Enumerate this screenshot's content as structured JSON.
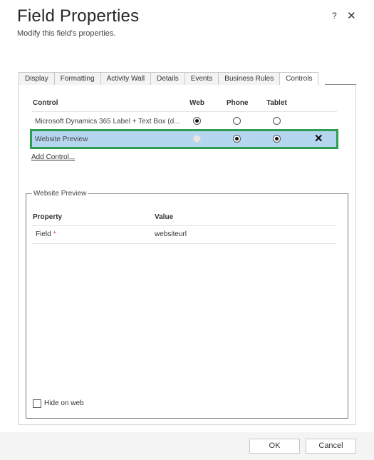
{
  "dialog": {
    "title": "Field Properties",
    "subtitle": "Modify this field's properties.",
    "help_label": "?",
    "close_label": "✕"
  },
  "tabs": [
    {
      "label": "Display",
      "active": false
    },
    {
      "label": "Formatting",
      "active": false
    },
    {
      "label": "Activity Wall",
      "active": false
    },
    {
      "label": "Details",
      "active": false
    },
    {
      "label": "Events",
      "active": false
    },
    {
      "label": "Business Rules",
      "active": false
    },
    {
      "label": "Controls",
      "active": true
    }
  ],
  "controls_table": {
    "columns": [
      "Control",
      "Web",
      "Phone",
      "Tablet"
    ],
    "rows": [
      {
        "name": "Microsoft Dynamics 365 Label + Text Box (d...",
        "web": "checked",
        "phone": "unchecked",
        "tablet": "unchecked",
        "selected": false
      },
      {
        "name": "Website Preview",
        "web": "disabled",
        "phone": "checked",
        "tablet": "checked",
        "selected": true,
        "remove_label": "✕"
      }
    ],
    "add_control_label": "Add Control..."
  },
  "properties": {
    "legend": "Website Preview",
    "columns": [
      "Property",
      "Value"
    ],
    "rows": [
      {
        "property": "Field",
        "required_marker": "*",
        "value": "websiteurl"
      }
    ],
    "hide_on_web_label": "Hide on web",
    "hide_on_web_checked": false
  },
  "footer": {
    "ok_label": "OK",
    "cancel_label": "Cancel"
  },
  "colors": {
    "selection_fill": "#b5d6ef",
    "selection_border": "#2e9e52",
    "required": "#d9434f"
  }
}
